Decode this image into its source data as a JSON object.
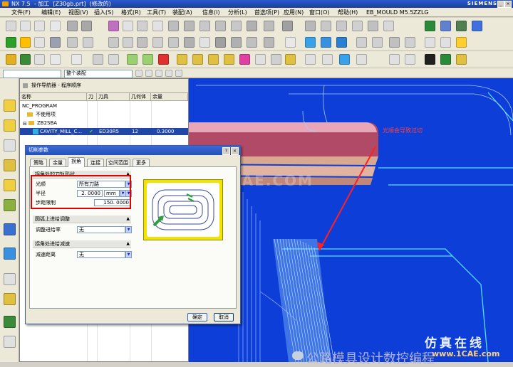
{
  "window": {
    "title_left": "NX 7.5",
    "title_mid": "加工",
    "title_file": "[Z30gb.prt]",
    "title_status": "(修改的)",
    "brand": "SIEMENS"
  },
  "menu": [
    "文件(F)",
    "编辑(E)",
    "视图(V)",
    "插入(S)",
    "格式(R)",
    "工具(T)",
    "装配(A)",
    "信息(I)",
    "分析(L)",
    "首选项(P)",
    "应用(N)",
    "窗口(O)",
    "帮助(H)",
    "EB_MOULD M5.5",
    "ZZLG"
  ],
  "navigator": {
    "panel_title": "操作导航器 - 程序顺序",
    "columns": [
      "名称",
      "刀",
      "刀具",
      "几何体",
      "余量"
    ],
    "rows": [
      {
        "name": "NC_PROGRAM",
        "tool_check": "",
        "tool": "",
        "geometry": "",
        "stock": ""
      },
      {
        "name": "不使用项",
        "tool_check": "",
        "tool": "",
        "geometry": "",
        "stock": ""
      },
      {
        "name": "ZB2SBA",
        "tool_check": "",
        "tool": "",
        "geometry": "",
        "stock": ""
      },
      {
        "name": "CAVITY_MILL_C...",
        "tool_check": "✔",
        "tool": "ED30R5",
        "geometry": "12",
        "stock": "0.3000"
      }
    ]
  },
  "selection_bar": {
    "filter": "",
    "scope": "整个装配"
  },
  "dialog": {
    "title": "切削参数",
    "tabs": [
      "策略",
      "余量",
      "拐角",
      "连接",
      "空间范围",
      "更多"
    ],
    "active_tab": "拐角",
    "group1_title": "拐角处的刀轨形状",
    "smooth_label": "光顺",
    "smooth_value": "所有刀路",
    "radius_label": "半径",
    "radius_value": "2. 0000",
    "radius_unit": "mm",
    "step_limit_label": "步距限制",
    "step_limit_value": "150. 0000",
    "group2_title": "圆弧上进给调整",
    "feed_adjust_label": "调整进给率",
    "feed_adjust_value": "无",
    "group3_title": "拐角处进给减速",
    "decel_label": "减速距离",
    "decel_value": "无",
    "ok_label": "确定",
    "cancel_label": "取消"
  },
  "annotation": {
    "text": "光顺会导致过切",
    "color": "#ff2020"
  },
  "watermarks": {
    "site_cn": "仿真在线",
    "site_url": "www.1CAE.com",
    "center": "1CAE.COM",
    "bottom_text": "公路模具设计数控编程",
    "bottom_logo": "wechat-logo-icon"
  },
  "icons": {
    "titlebar": [
      "nx-logo-icon"
    ],
    "preview": "toolpath-corner-preview-icon"
  }
}
